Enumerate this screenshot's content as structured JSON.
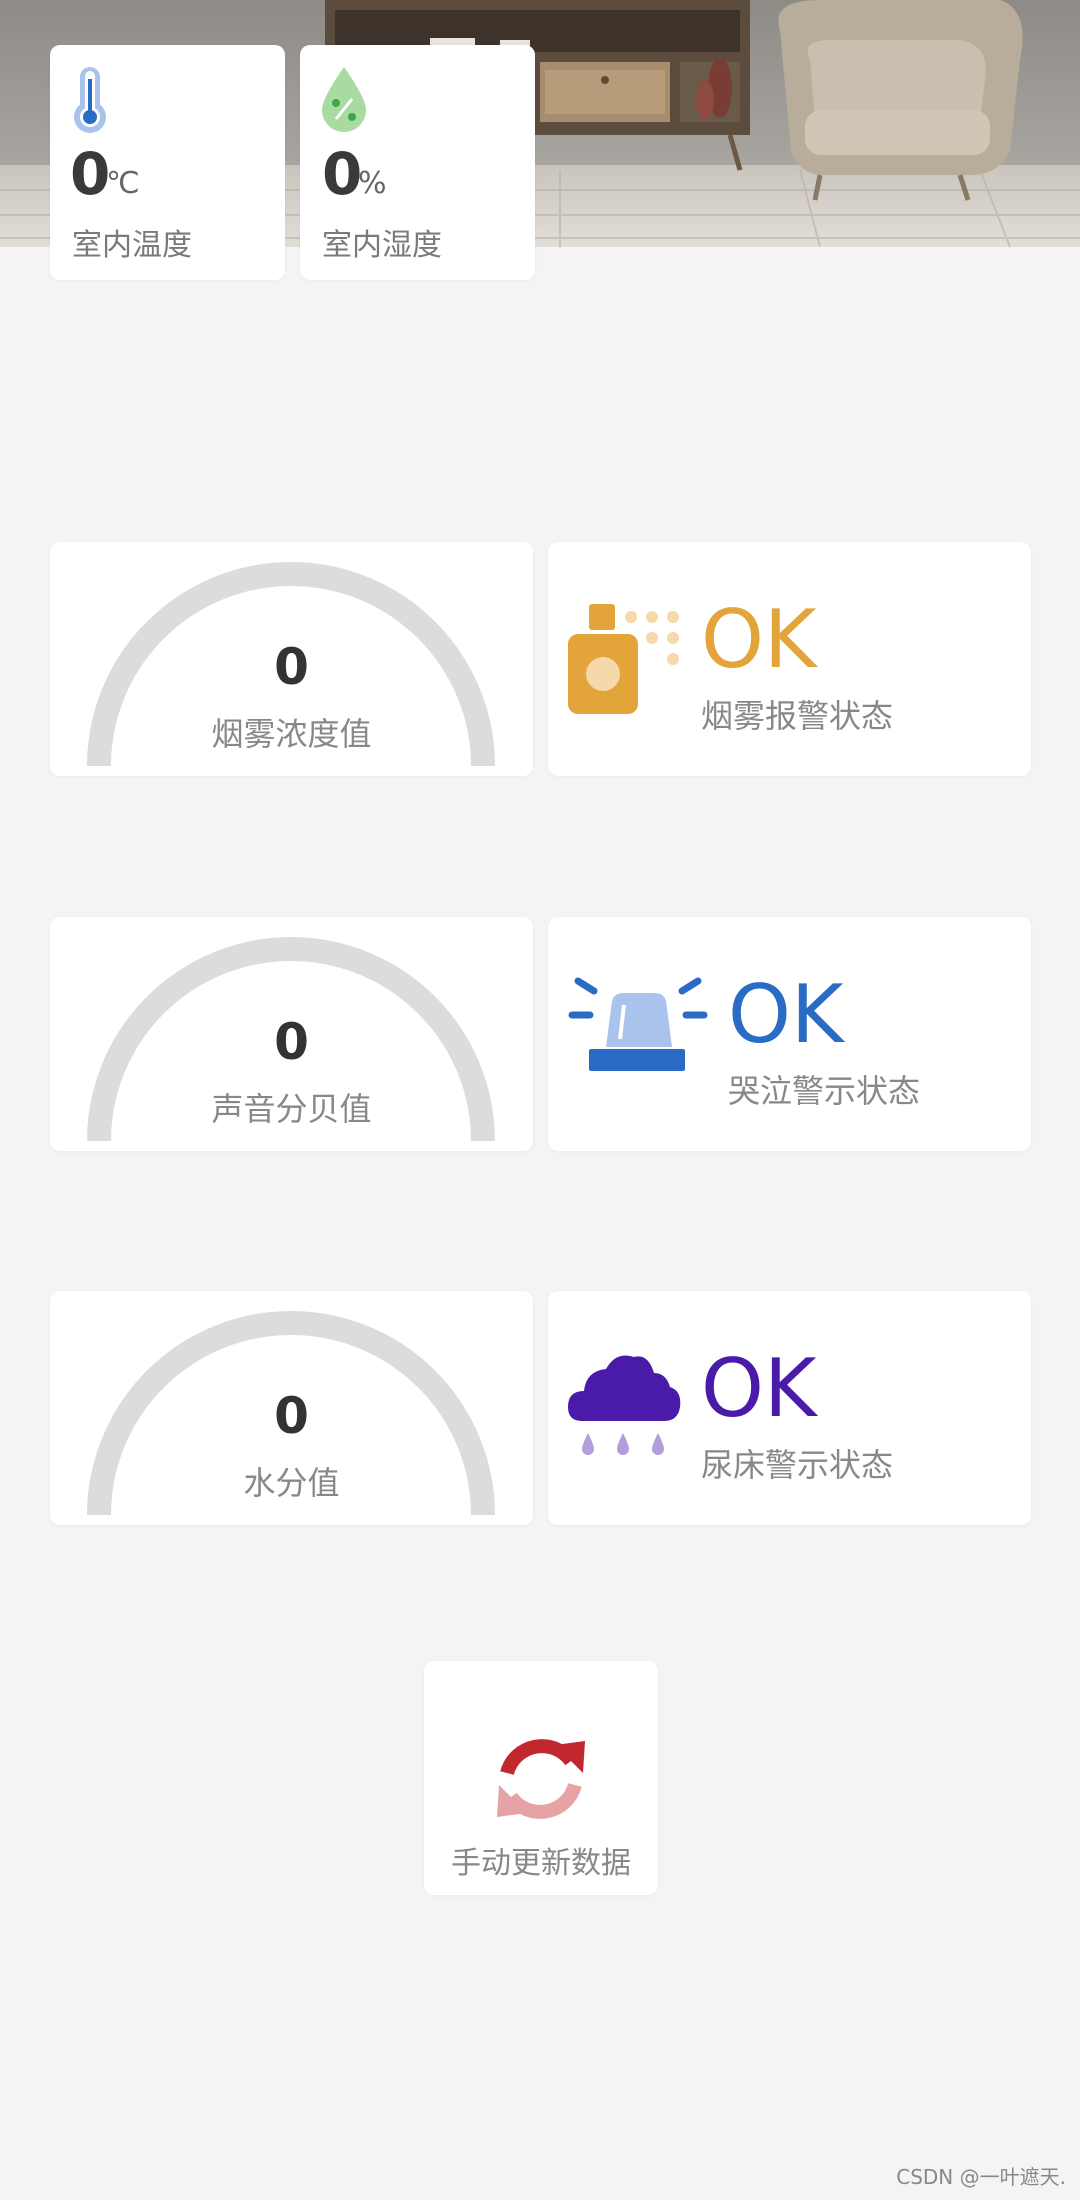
{
  "header": {
    "temperature": {
      "value": "0",
      "unit": "℃",
      "label": "室内温度"
    },
    "humidity": {
      "value": "0",
      "unit": "%",
      "label": "室内湿度"
    }
  },
  "gauges": [
    {
      "value": "0",
      "label": "烟雾浓度值"
    },
    {
      "value": "0",
      "label": "声音分贝值"
    },
    {
      "value": "0",
      "label": "水分值"
    }
  ],
  "statuses": [
    {
      "value": "OK",
      "label": "烟雾报警状态",
      "color": "#E3A43C",
      "icon": "smoke-detector-icon"
    },
    {
      "value": "OK",
      "label": "哭泣警示状态",
      "color": "#2A6BC6",
      "icon": "siren-icon"
    },
    {
      "value": "OK",
      "label": "尿床警示状态",
      "color": "#4A1BA8",
      "icon": "rain-cloud-icon"
    }
  ],
  "refresh": {
    "label": "手动更新数据",
    "icon": "refresh-icon"
  },
  "watermark": "CSDN @一叶遮天."
}
